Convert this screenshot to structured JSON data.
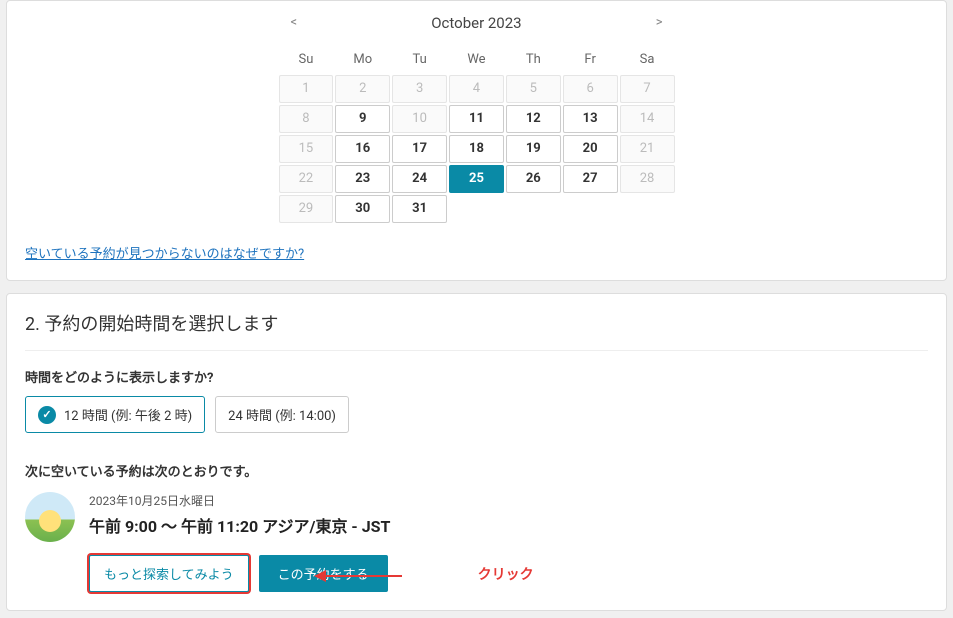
{
  "calendar": {
    "prev": "<",
    "next": ">",
    "title": "October 2023",
    "dow": [
      "Su",
      "Mo",
      "Tu",
      "We",
      "Th",
      "Fr",
      "Sa"
    ],
    "weeks": [
      [
        {
          "n": "1"
        },
        {
          "n": "2"
        },
        {
          "n": "3"
        },
        {
          "n": "4"
        },
        {
          "n": "5"
        },
        {
          "n": "6"
        },
        {
          "n": "7"
        }
      ],
      [
        {
          "n": "8"
        },
        {
          "n": "9",
          "a": true
        },
        {
          "n": "10"
        },
        {
          "n": "11",
          "a": true
        },
        {
          "n": "12",
          "a": true
        },
        {
          "n": "13",
          "a": true
        },
        {
          "n": "14"
        }
      ],
      [
        {
          "n": "15"
        },
        {
          "n": "16",
          "a": true
        },
        {
          "n": "17",
          "a": true
        },
        {
          "n": "18",
          "a": true
        },
        {
          "n": "19",
          "a": true
        },
        {
          "n": "20",
          "a": true
        },
        {
          "n": "21"
        }
      ],
      [
        {
          "n": "22"
        },
        {
          "n": "23",
          "a": true
        },
        {
          "n": "24",
          "a": true
        },
        {
          "n": "25",
          "a": true,
          "s": true
        },
        {
          "n": "26",
          "a": true
        },
        {
          "n": "27",
          "a": true
        },
        {
          "n": "28"
        }
      ],
      [
        {
          "n": "29"
        },
        {
          "n": "30",
          "a": true
        },
        {
          "n": "31",
          "a": true
        },
        {
          "n": ""
        },
        {
          "n": ""
        },
        {
          "n": ""
        },
        {
          "n": ""
        }
      ]
    ]
  },
  "help_link": "空いている予約が見つからないのはなぜですか?",
  "section2_title": "2. 予約の開始時間を選択します",
  "time_format": {
    "question": "時間をどのように表示しますか?",
    "opt12": "12 時間 (例: 午後 2 時)",
    "opt24": "24 時間 (例: 14:00)"
  },
  "next_available_label": "次に空いている予約は次のとおりです。",
  "slot": {
    "date": "2023年10月25日水曜日",
    "time": "午前 9:00 ～ 午前 11:20 アジア/東京 - JST",
    "explore_btn": "もっと探索してみよう",
    "book_btn": "この予約をする"
  },
  "annotation": {
    "label": "クリック"
  }
}
